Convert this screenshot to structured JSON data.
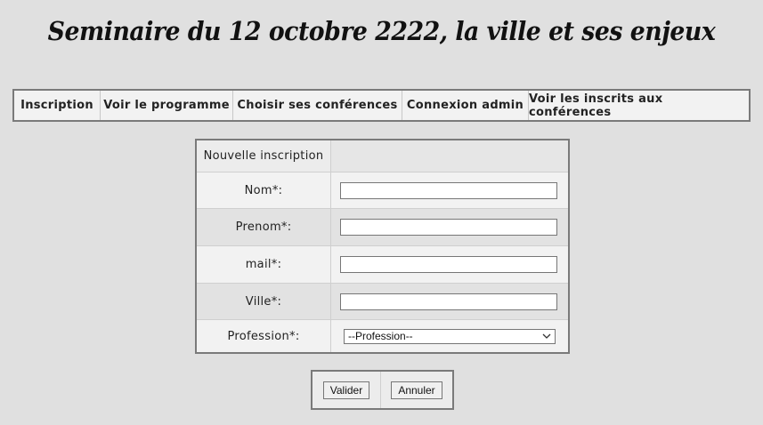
{
  "header": {
    "title": "Seminaire du 12 octobre 2222, la ville et ses enjeux"
  },
  "nav": {
    "items": [
      {
        "label": "Inscription"
      },
      {
        "label": "Voir le programme"
      },
      {
        "label": "Choisir ses conférences"
      },
      {
        "label": "Connexion admin"
      },
      {
        "label": "Voir les inscrits aux conférences"
      }
    ]
  },
  "form": {
    "heading": "Nouvelle inscription",
    "fields": [
      {
        "label": "Nom*:",
        "value": ""
      },
      {
        "label": "Prenom*:",
        "value": ""
      },
      {
        "label": "mail*:",
        "value": ""
      },
      {
        "label": "Ville*:",
        "value": ""
      }
    ],
    "profession": {
      "label": "Profession*:",
      "selected": "--Profession--"
    }
  },
  "actions": {
    "submit_label": "Valider",
    "cancel_label": "Annuler"
  }
}
